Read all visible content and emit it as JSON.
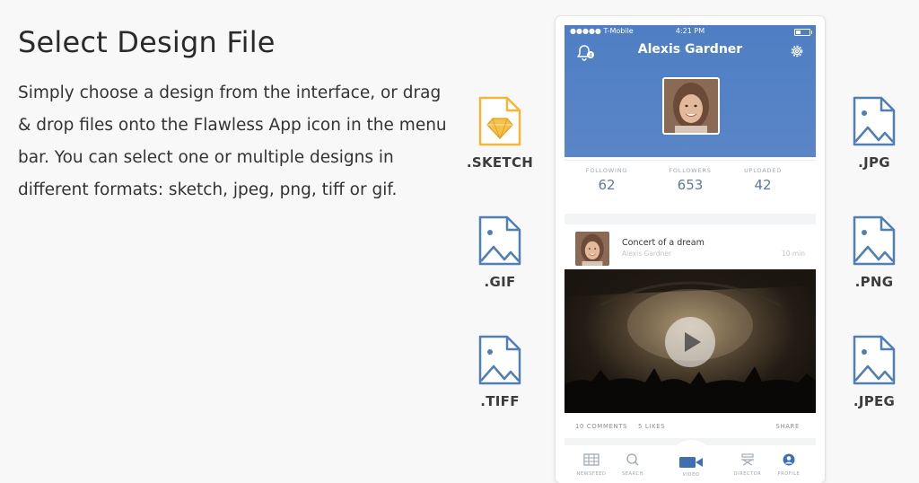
{
  "heading": "Select Design File",
  "description": "Simply choose a design from the interface, or drag & drop files onto the Flawless App icon in the menu bar. You can select one or multiple designs in different formats: sketch, jpeg, png, tiff or gif.",
  "formats": {
    "sketch": ".SKETCH",
    "gif": ".GIF",
    "tiff": ".TIFF",
    "jpg": ".JPG",
    "png": ".PNG",
    "jpeg": ".JPEG"
  },
  "colors": {
    "file_icon_blue": "#4f7fb5",
    "sketch_orange": "#f2b63b",
    "header_blue": "#5382c6"
  },
  "phone": {
    "status": {
      "carrier": "●●●●● T-Mobile",
      "time": "4:21 PM"
    },
    "profile": {
      "name": "Alexis Gardner"
    },
    "stats": [
      {
        "label": "FOLLOWING",
        "value": "62"
      },
      {
        "label": "FOLLOWERS",
        "value": "653"
      },
      {
        "label": "UPLOADED",
        "value": "42"
      }
    ],
    "post": {
      "title": "Concert of a dream",
      "author": "Alexis Gardner",
      "time": "10 min",
      "comments": "10 COMMENTS",
      "likes": "5 LIKES",
      "share": "SHARE"
    },
    "tabs": [
      "NEWSFEED",
      "SEARCH",
      "VIDEO",
      "DIRECTOR",
      "PROFILE"
    ]
  }
}
